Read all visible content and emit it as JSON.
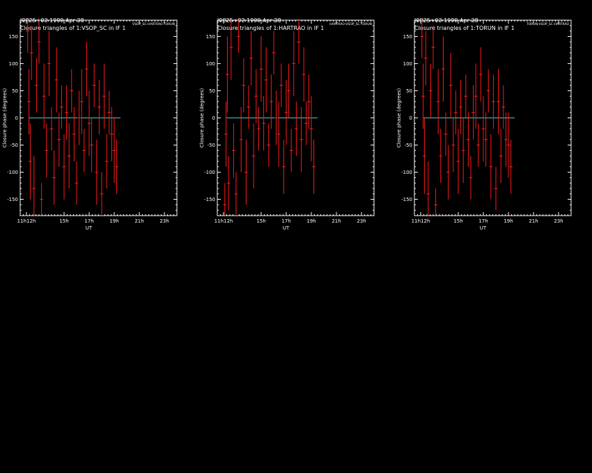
{
  "page": {
    "background": "#000000"
  },
  "colors": {
    "text": "#ffffff",
    "points": "#ff1a1a",
    "zero_line": "#3fd0d0"
  },
  "chart_data": [
    {
      "type": "scatter",
      "source_title": "J0825+03  1999 Apr 28",
      "title": "Closure triangles of 1:VSOP_SC in IF 1",
      "stamp": "VSOP_SC-HARTRAO-TORUN",
      "xlabel": "UT",
      "ylabel": "Closure phase  (degrees)",
      "xlim": [
        11.5,
        24
      ],
      "ylim": [
        -180,
        180
      ],
      "xticks": [
        {
          "v": 12,
          "label": "11h12h"
        },
        {
          "v": 15,
          "label": "15h"
        },
        {
          "v": 17,
          "label": "17h"
        },
        {
          "v": 19,
          "label": "19h"
        },
        {
          "v": 21,
          "label": "21h"
        },
        {
          "v": 23,
          "label": "23h"
        }
      ],
      "yticks": [
        -150,
        -100,
        -50,
        0,
        50,
        100,
        150
      ],
      "series": [
        {
          "x": [
            12.1,
            12.2,
            12.3,
            12.4,
            12.6,
            12.8,
            13.0,
            13.2,
            13.4,
            13.6,
            13.8,
            14.0,
            14.2,
            14.4,
            14.6,
            14.8,
            15.0,
            15.2,
            15.4,
            15.6,
            15.8,
            16.0,
            16.2,
            16.4,
            16.6,
            16.8,
            17.0,
            17.2,
            17.4,
            17.6,
            17.8,
            18.0,
            18.2,
            18.4,
            18.6,
            18.8,
            19.0,
            19.2
          ],
          "y": [
            160,
            30,
            -80,
            120,
            -130,
            60,
            140,
            -150,
            40,
            -60,
            100,
            -20,
            -110,
            70,
            -40,
            20,
            -90,
            10,
            -70,
            50,
            -30,
            -120,
            0,
            30,
            -60,
            90,
            -10,
            -50,
            60,
            -100,
            20,
            -140,
            40,
            -80,
            10,
            -30,
            -60,
            -90
          ],
          "err": [
            40,
            60,
            70,
            50,
            60,
            50,
            40,
            30,
            60,
            50,
            60,
            40,
            50,
            60,
            50,
            40,
            60,
            50,
            60,
            40,
            50,
            40,
            50,
            60,
            40,
            50,
            60,
            50,
            40,
            60,
            50,
            40,
            60,
            50,
            40,
            50,
            60,
            50
          ]
        }
      ]
    },
    {
      "type": "scatter",
      "source_title": "J0825+03  1999 Apr 28",
      "title": "Closure triangles of 1:HARTRAO in IF 1",
      "stamp": "HARTRAO-VSOP_SC-TORUN",
      "xlabel": "UT",
      "ylabel": "Closure phase  (degrees)",
      "xlim": [
        11.5,
        24
      ],
      "ylim": [
        -180,
        180
      ],
      "xticks": [
        {
          "v": 12,
          "label": "11h12h"
        },
        {
          "v": 15,
          "label": "15h"
        },
        {
          "v": 17,
          "label": "17h"
        },
        {
          "v": 19,
          "label": "19h"
        },
        {
          "v": 21,
          "label": "21h"
        },
        {
          "v": 23,
          "label": "23h"
        }
      ],
      "yticks": [
        -150,
        -100,
        -50,
        0,
        50,
        100,
        150
      ],
      "series": [
        {
          "x": [
            12.1,
            12.2,
            12.3,
            12.4,
            12.6,
            12.8,
            13.0,
            13.2,
            13.4,
            13.6,
            13.8,
            14.0,
            14.2,
            14.4,
            14.6,
            14.8,
            15.0,
            15.2,
            15.4,
            15.6,
            15.8,
            16.0,
            16.2,
            16.4,
            16.6,
            16.8,
            17.0,
            17.2,
            17.4,
            17.6,
            17.8,
            18.0,
            18.2,
            18.4,
            18.6,
            18.8,
            19.0,
            19.2
          ],
          "y": [
            -160,
            -30,
            80,
            -120,
            130,
            -60,
            -140,
            150,
            -40,
            60,
            -100,
            20,
            110,
            -70,
            40,
            -20,
            90,
            -10,
            70,
            -50,
            30,
            120,
            0,
            -30,
            60,
            -90,
            10,
            50,
            -60,
            100,
            -20,
            140,
            -40,
            80,
            -10,
            30,
            -20,
            -90
          ],
          "err": [
            40,
            60,
            70,
            50,
            60,
            50,
            40,
            30,
            60,
            50,
            60,
            40,
            50,
            60,
            50,
            40,
            60,
            50,
            60,
            40,
            50,
            40,
            50,
            60,
            40,
            50,
            60,
            50,
            40,
            60,
            50,
            40,
            60,
            50,
            40,
            50,
            60,
            50
          ]
        }
      ]
    },
    {
      "type": "scatter",
      "source_title": "J0825+03  1999 Apr 28",
      "title": "Closure triangles of 1:TORUN in IF 1",
      "stamp": "TORUN-VSOP_SC-HARTRAO",
      "xlabel": "UT",
      "ylabel": "Closure phase  (degrees)",
      "xlim": [
        11.5,
        24
      ],
      "ylim": [
        -180,
        180
      ],
      "xticks": [
        {
          "v": 12,
          "label": "11h12h"
        },
        {
          "v": 15,
          "label": "15h"
        },
        {
          "v": 17,
          "label": "17h"
        },
        {
          "v": 19,
          "label": "19h"
        },
        {
          "v": 21,
          "label": "21h"
        },
        {
          "v": 23,
          "label": "23h"
        }
      ],
      "yticks": [
        -150,
        -100,
        -50,
        0,
        50,
        100,
        150
      ],
      "series": [
        {
          "x": [
            12.1,
            12.2,
            12.3,
            12.4,
            12.6,
            12.8,
            13.0,
            13.2,
            13.4,
            13.6,
            13.8,
            14.0,
            14.2,
            14.4,
            14.6,
            14.8,
            15.0,
            15.2,
            15.4,
            15.6,
            15.8,
            16.0,
            16.2,
            16.4,
            16.6,
            16.8,
            17.0,
            17.2,
            17.4,
            17.6,
            17.8,
            18.0,
            18.2,
            18.4,
            18.6,
            18.8,
            19.0,
            19.2
          ],
          "y": [
            150,
            40,
            -70,
            110,
            -140,
            50,
            130,
            -160,
            30,
            -70,
            90,
            -30,
            -100,
            60,
            -50,
            10,
            -80,
            20,
            -60,
            40,
            -40,
            -110,
            10,
            40,
            -50,
            80,
            -20,
            -40,
            50,
            -90,
            30,
            -130,
            30,
            -70,
            20,
            -40,
            -50,
            -90
          ],
          "err": [
            40,
            60,
            70,
            50,
            60,
            50,
            40,
            30,
            60,
            50,
            60,
            40,
            50,
            60,
            50,
            40,
            60,
            50,
            60,
            40,
            50,
            40,
            50,
            60,
            40,
            50,
            60,
            50,
            40,
            60,
            50,
            40,
            60,
            50,
            40,
            50,
            60,
            50
          ]
        }
      ]
    }
  ]
}
